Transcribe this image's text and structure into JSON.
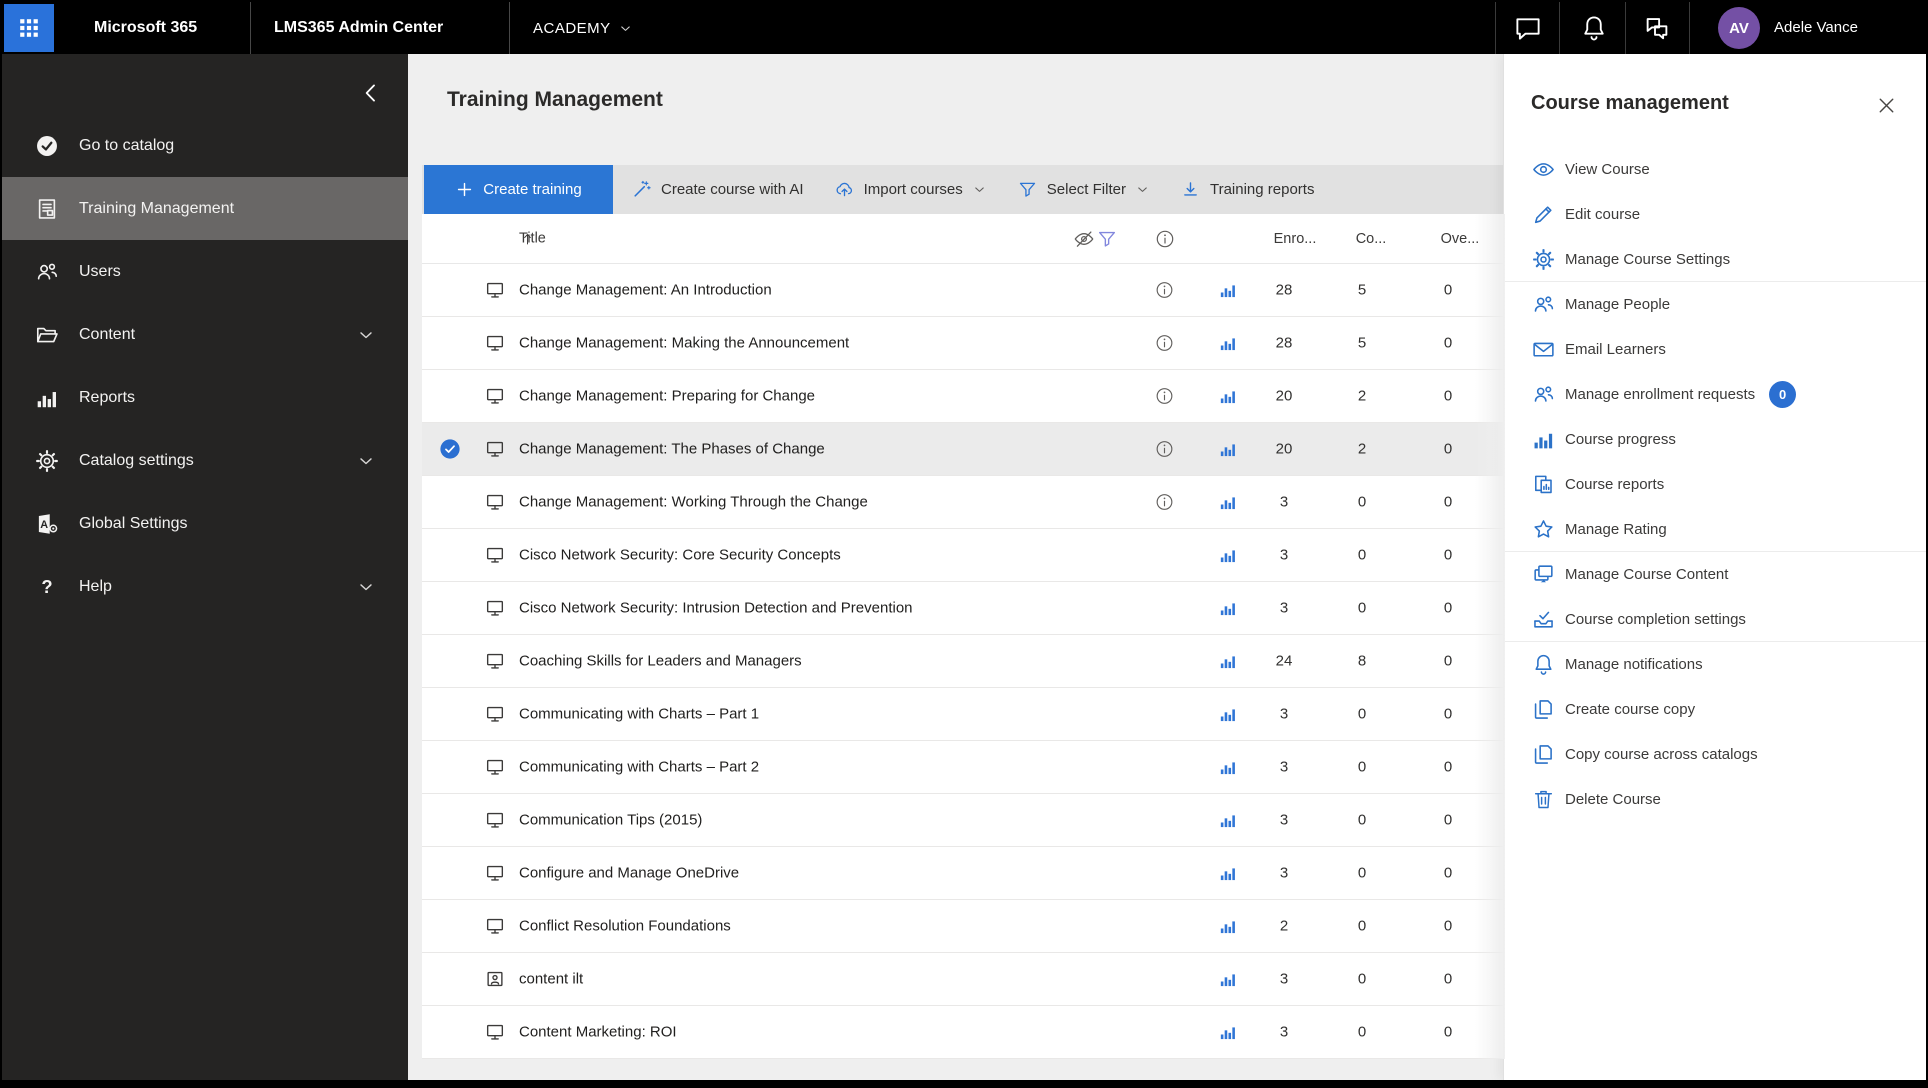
{
  "colors": {
    "accent_blue": "#2b76d4",
    "icon_blue": "#2b72c8",
    "avatar_purple": "#7450a5",
    "badge_blue": "#2b6fd1",
    "topbar_bg": "#000000",
    "sidebar_bg": "#252423",
    "sidebar_selected": "#696766",
    "page_bg": "#efefef",
    "toolbar_bg": "#e1e1e1"
  },
  "topbar": {
    "brand": "Microsoft 365",
    "app": "LMS365 Admin Center",
    "tenant": "ACADEMY",
    "user": {
      "initials": "AV",
      "name": "Adele Vance"
    }
  },
  "sidebar": {
    "items": [
      {
        "label": "Go to catalog",
        "icon": "catalog-check",
        "selected": false,
        "chevron": false
      },
      {
        "label": "Training Management",
        "icon": "doc-list",
        "selected": true,
        "chevron": false
      },
      {
        "label": "Users",
        "icon": "users",
        "selected": false,
        "chevron": false
      },
      {
        "label": "Content",
        "icon": "folder",
        "selected": false,
        "chevron": true
      },
      {
        "label": "Reports",
        "icon": "bars",
        "selected": false,
        "chevron": false
      },
      {
        "label": "Catalog settings",
        "icon": "gear",
        "selected": false,
        "chevron": true
      },
      {
        "label": "Global Settings",
        "icon": "app-a",
        "selected": false,
        "chevron": false
      },
      {
        "label": "Help",
        "icon": "question",
        "selected": false,
        "chevron": true
      }
    ]
  },
  "main": {
    "title": "Training Management",
    "toolbar": [
      {
        "label": "Create training",
        "icon": "plus",
        "primary": true,
        "chevron": false
      },
      {
        "label": "Create course with AI",
        "icon": "wand",
        "primary": false,
        "chevron": false
      },
      {
        "label": "Import courses",
        "icon": "cloud-up",
        "primary": false,
        "chevron": true
      },
      {
        "label": "Select Filter",
        "icon": "filter",
        "primary": false,
        "chevron": true
      },
      {
        "label": "Training reports",
        "icon": "download",
        "primary": false,
        "chevron": false
      }
    ],
    "table": {
      "columns": {
        "title": "Title",
        "enrolled": "Enro...",
        "completed": "Co...",
        "overdue": "Ove..."
      },
      "rows": [
        {
          "title": "Change Management: An Introduction",
          "type": "elearning",
          "info": true,
          "selected": false,
          "enrolled": 28,
          "completed": 5,
          "overdue": 0
        },
        {
          "title": "Change Management: Making the Announcement",
          "type": "elearning",
          "info": true,
          "selected": false,
          "enrolled": 28,
          "completed": 5,
          "overdue": 0
        },
        {
          "title": "Change Management: Preparing for Change",
          "type": "elearning",
          "info": true,
          "selected": false,
          "enrolled": 20,
          "completed": 2,
          "overdue": 0
        },
        {
          "title": "Change Management: The Phases of Change",
          "type": "elearning",
          "info": true,
          "selected": true,
          "enrolled": 20,
          "completed": 2,
          "overdue": 0
        },
        {
          "title": "Change Management: Working Through the Change",
          "type": "elearning",
          "info": true,
          "selected": false,
          "enrolled": 3,
          "completed": 0,
          "overdue": 0
        },
        {
          "title": "Cisco Network Security: Core Security Concepts",
          "type": "elearning",
          "info": false,
          "selected": false,
          "enrolled": 3,
          "completed": 0,
          "overdue": 0
        },
        {
          "title": "Cisco Network Security: Intrusion Detection and Prevention",
          "type": "elearning",
          "info": false,
          "selected": false,
          "enrolled": 3,
          "completed": 0,
          "overdue": 0
        },
        {
          "title": "Coaching Skills for Leaders and Managers",
          "type": "elearning",
          "info": false,
          "selected": false,
          "enrolled": 24,
          "completed": 8,
          "overdue": 0
        },
        {
          "title": "Communicating with Charts – Part 1",
          "type": "elearning",
          "info": false,
          "selected": false,
          "enrolled": 3,
          "completed": 0,
          "overdue": 0
        },
        {
          "title": "Communicating with Charts – Part 2",
          "type": "elearning",
          "info": false,
          "selected": false,
          "enrolled": 3,
          "completed": 0,
          "overdue": 0
        },
        {
          "title": "Communication Tips (2015)",
          "type": "elearning",
          "info": false,
          "selected": false,
          "enrolled": 3,
          "completed": 0,
          "overdue": 0
        },
        {
          "title": "Configure and Manage OneDrive",
          "type": "elearning",
          "info": false,
          "selected": false,
          "enrolled": 3,
          "completed": 0,
          "overdue": 0
        },
        {
          "title": "Conflict Resolution Foundations",
          "type": "elearning",
          "info": false,
          "selected": false,
          "enrolled": 2,
          "completed": 0,
          "overdue": 0
        },
        {
          "title": "content ilt",
          "type": "ilt",
          "info": false,
          "selected": false,
          "enrolled": 3,
          "completed": 0,
          "overdue": 0
        },
        {
          "title": "Content Marketing: ROI",
          "type": "elearning",
          "info": false,
          "selected": false,
          "enrolled": 3,
          "completed": 0,
          "overdue": 0
        }
      ]
    }
  },
  "panel": {
    "title": "Course management",
    "items": [
      {
        "label": "View Course",
        "icon": "eye"
      },
      {
        "label": "Edit course",
        "icon": "pencil"
      },
      {
        "label": "Manage Course Settings",
        "icon": "gear",
        "divider_after": true
      },
      {
        "label": "Manage People",
        "icon": "users"
      },
      {
        "label": "Email Learners",
        "icon": "mail"
      },
      {
        "label": "Manage enrollment requests",
        "icon": "users",
        "badge": "0"
      },
      {
        "label": "Course progress",
        "icon": "bars"
      },
      {
        "label": "Course reports",
        "icon": "report"
      },
      {
        "label": "Manage Rating",
        "icon": "star",
        "divider_after": true
      },
      {
        "label": "Manage Course Content",
        "icon": "layers"
      },
      {
        "label": "Course completion settings",
        "icon": "completion",
        "divider_after": true
      },
      {
        "label": "Manage notifications",
        "icon": "bell"
      },
      {
        "label": "Create course copy",
        "icon": "copy"
      },
      {
        "label": "Copy course across catalogs",
        "icon": "copy"
      },
      {
        "label": "Delete Course",
        "icon": "trash"
      }
    ]
  }
}
